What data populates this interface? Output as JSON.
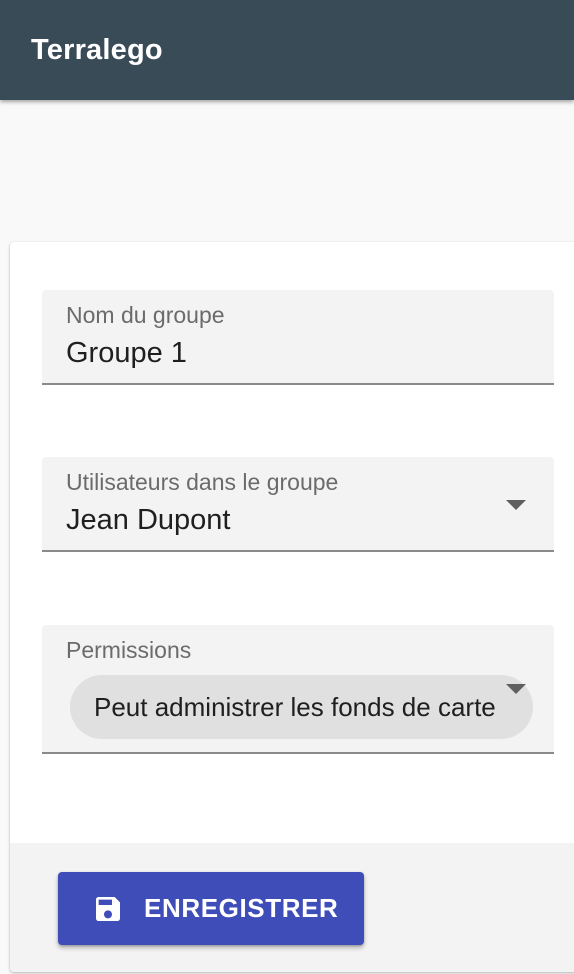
{
  "app": {
    "title": "Terralego"
  },
  "form": {
    "group_name": {
      "label": "Nom du groupe",
      "value": "Groupe 1"
    },
    "users": {
      "label": "Utilisateurs dans le groupe",
      "value": "Jean Dupont"
    },
    "permissions": {
      "label": "Permissions",
      "chips": [
        "Peut administrer les fonds de carte"
      ]
    }
  },
  "actions": {
    "save_label": "ENREGISTRER",
    "save_icon": "floppy-disk-icon"
  },
  "colors": {
    "app_bar": "#3a4b58",
    "primary": "#3f4db8",
    "field_bg": "#f3f3f3",
    "chip_bg": "#e0e0e0"
  }
}
